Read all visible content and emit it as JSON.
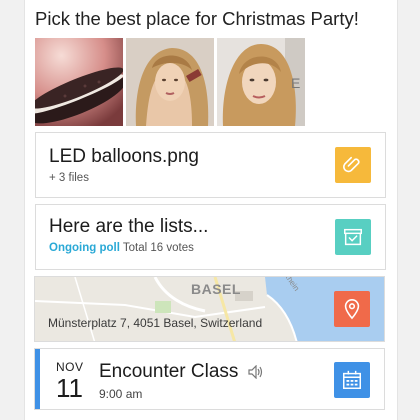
{
  "poll": {
    "question": "Pick the best place for Christmas Party!"
  },
  "attachment_card": {
    "title": "LED balloons.png",
    "subtitle": "+ 3 files",
    "icon": "paperclip-icon",
    "tile_color": "#f6b93b"
  },
  "poll_card": {
    "title": "Here are the lists...",
    "status": "Ongoing poll",
    "votes_text": "Total 16 votes",
    "icon": "inbox-tray-icon",
    "tile_color": "#58cfc2"
  },
  "location_card": {
    "city_label": "BASEL",
    "road_label": "Rhein",
    "address": "Münsterplatz 7, 4051 Basel, Switzerland",
    "icon": "map-pin-icon",
    "tile_color": "#f06a4a"
  },
  "event_card": {
    "month": "NOV",
    "day": "11",
    "title": "Encounter Class",
    "time": "9:00 am",
    "icon": "calendar-icon",
    "tile_color": "#3f91e6",
    "accent_color": "#3f91e6"
  }
}
